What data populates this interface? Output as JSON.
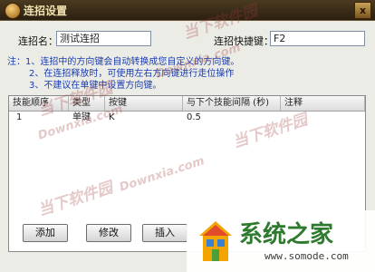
{
  "window": {
    "title": "连招设置",
    "close_glyph": "x"
  },
  "form": {
    "name_label": "连招名：",
    "name_value": "测试连招",
    "hotkey_label": "连招快捷键：",
    "hotkey_value": "F2"
  },
  "notes": [
    "注：1、连招中的方向键会自动转换成您自定义的方向键。",
    "2、在连招释放时，可使用左右方向键进行走位操作",
    "3、不建议在单键中设置方向键。"
  ],
  "table": {
    "headers": [
      "技能顺序",
      "类型",
      "按键",
      "与下个技能间隔 (秒)",
      "注释"
    ],
    "rows": [
      [
        "1",
        "单键",
        "K",
        "0.5",
        ""
      ]
    ]
  },
  "buttons": {
    "add": "添加",
    "edit": "修改",
    "insert": "插入"
  },
  "watermark": {
    "site_cn": "当下软件园",
    "site_en": "Downxia.com",
    "logo_cn": "系统之家",
    "logo_url": "www.somode.com"
  },
  "colors": {
    "notes_blue": "#1a3cb0",
    "logo_green": "#2e7a2e",
    "title_gold": "#f0e2b0"
  }
}
